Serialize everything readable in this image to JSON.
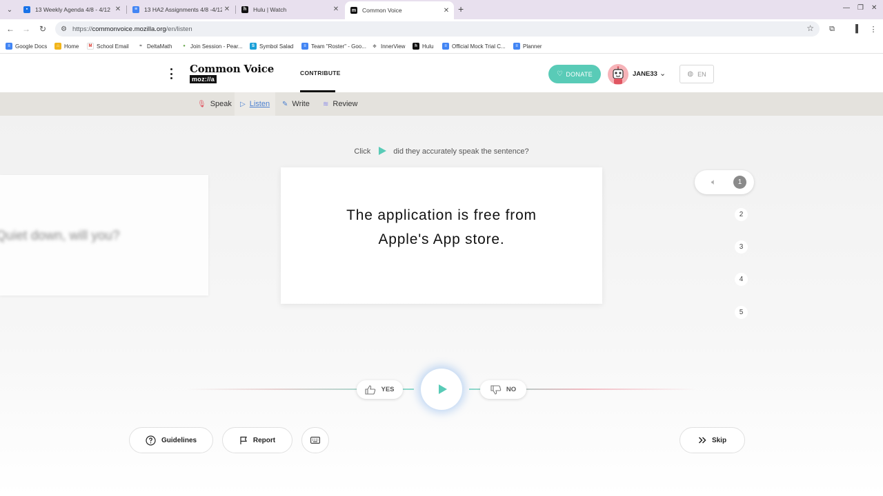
{
  "browser": {
    "tabs": [
      {
        "title": "13 Weekly Agenda 4/8 - 4/12",
        "icon": "google-classroom-icon",
        "color": "#1a73e8",
        "active": false
      },
      {
        "title": "13 HA2 Assignments 4/8 -4/12",
        "icon": "google-docs-icon",
        "color": "#4285f4",
        "active": false
      },
      {
        "title": "Hulu | Watch",
        "icon": "hulu-icon",
        "color": "#111111",
        "active": false
      },
      {
        "title": "Common Voice",
        "icon": "mozilla-icon",
        "color": "#111111",
        "active": true
      }
    ],
    "url": "https://commonvoice.mozilla.org/en/listen",
    "url_host": "commonvoice.mozilla.org",
    "url_path": "/en/listen",
    "bookmarks": [
      {
        "label": "Google Docs",
        "icon": "google-docs-icon"
      },
      {
        "label": "Home",
        "icon": "home-icon"
      },
      {
        "label": "School Email",
        "icon": "gmail-icon"
      },
      {
        "label": "DeltaMath",
        "icon": "deltamath-icon"
      },
      {
        "label": "Join Session - Pear...",
        "icon": "pear-deck-icon"
      },
      {
        "label": "Symbol Salad",
        "icon": "symbol-salad-icon"
      },
      {
        "label": "Team \"Roster\" - Goo...",
        "icon": "google-docs-icon"
      },
      {
        "label": "InnerView",
        "icon": "innerview-icon"
      },
      {
        "label": "Hulu",
        "icon": "hulu-icon"
      },
      {
        "label": "Official Mock Trial C...",
        "icon": "google-docs-icon"
      },
      {
        "label": "Planner",
        "icon": "google-docs-icon"
      }
    ]
  },
  "header": {
    "logo_title": "Common Voice",
    "logo_sub": "moz://a",
    "nav_contribute": "CONTRIBUTE",
    "donate": "DONATE",
    "username": "JANE33",
    "language": "EN"
  },
  "subnav": {
    "speak": "Speak",
    "listen": "Listen",
    "write": "Write",
    "review": "Review"
  },
  "main": {
    "instruction_before": "Click",
    "instruction_after": "did they accurately speak the sentence?",
    "sentence": "The application is free from Apple's App store.",
    "previous_sentence": "Quiet down, will you?",
    "clips": [
      "1",
      "2",
      "3",
      "4",
      "5"
    ],
    "yes": "YES",
    "no": "NO"
  },
  "footer": {
    "guidelines": "Guidelines",
    "report": "Report",
    "skip": "Skip"
  },
  "colors": {
    "accent": "#59cbb7",
    "listen_active": "#4a7fd0",
    "subnav_bg": "#e4e2dd"
  }
}
